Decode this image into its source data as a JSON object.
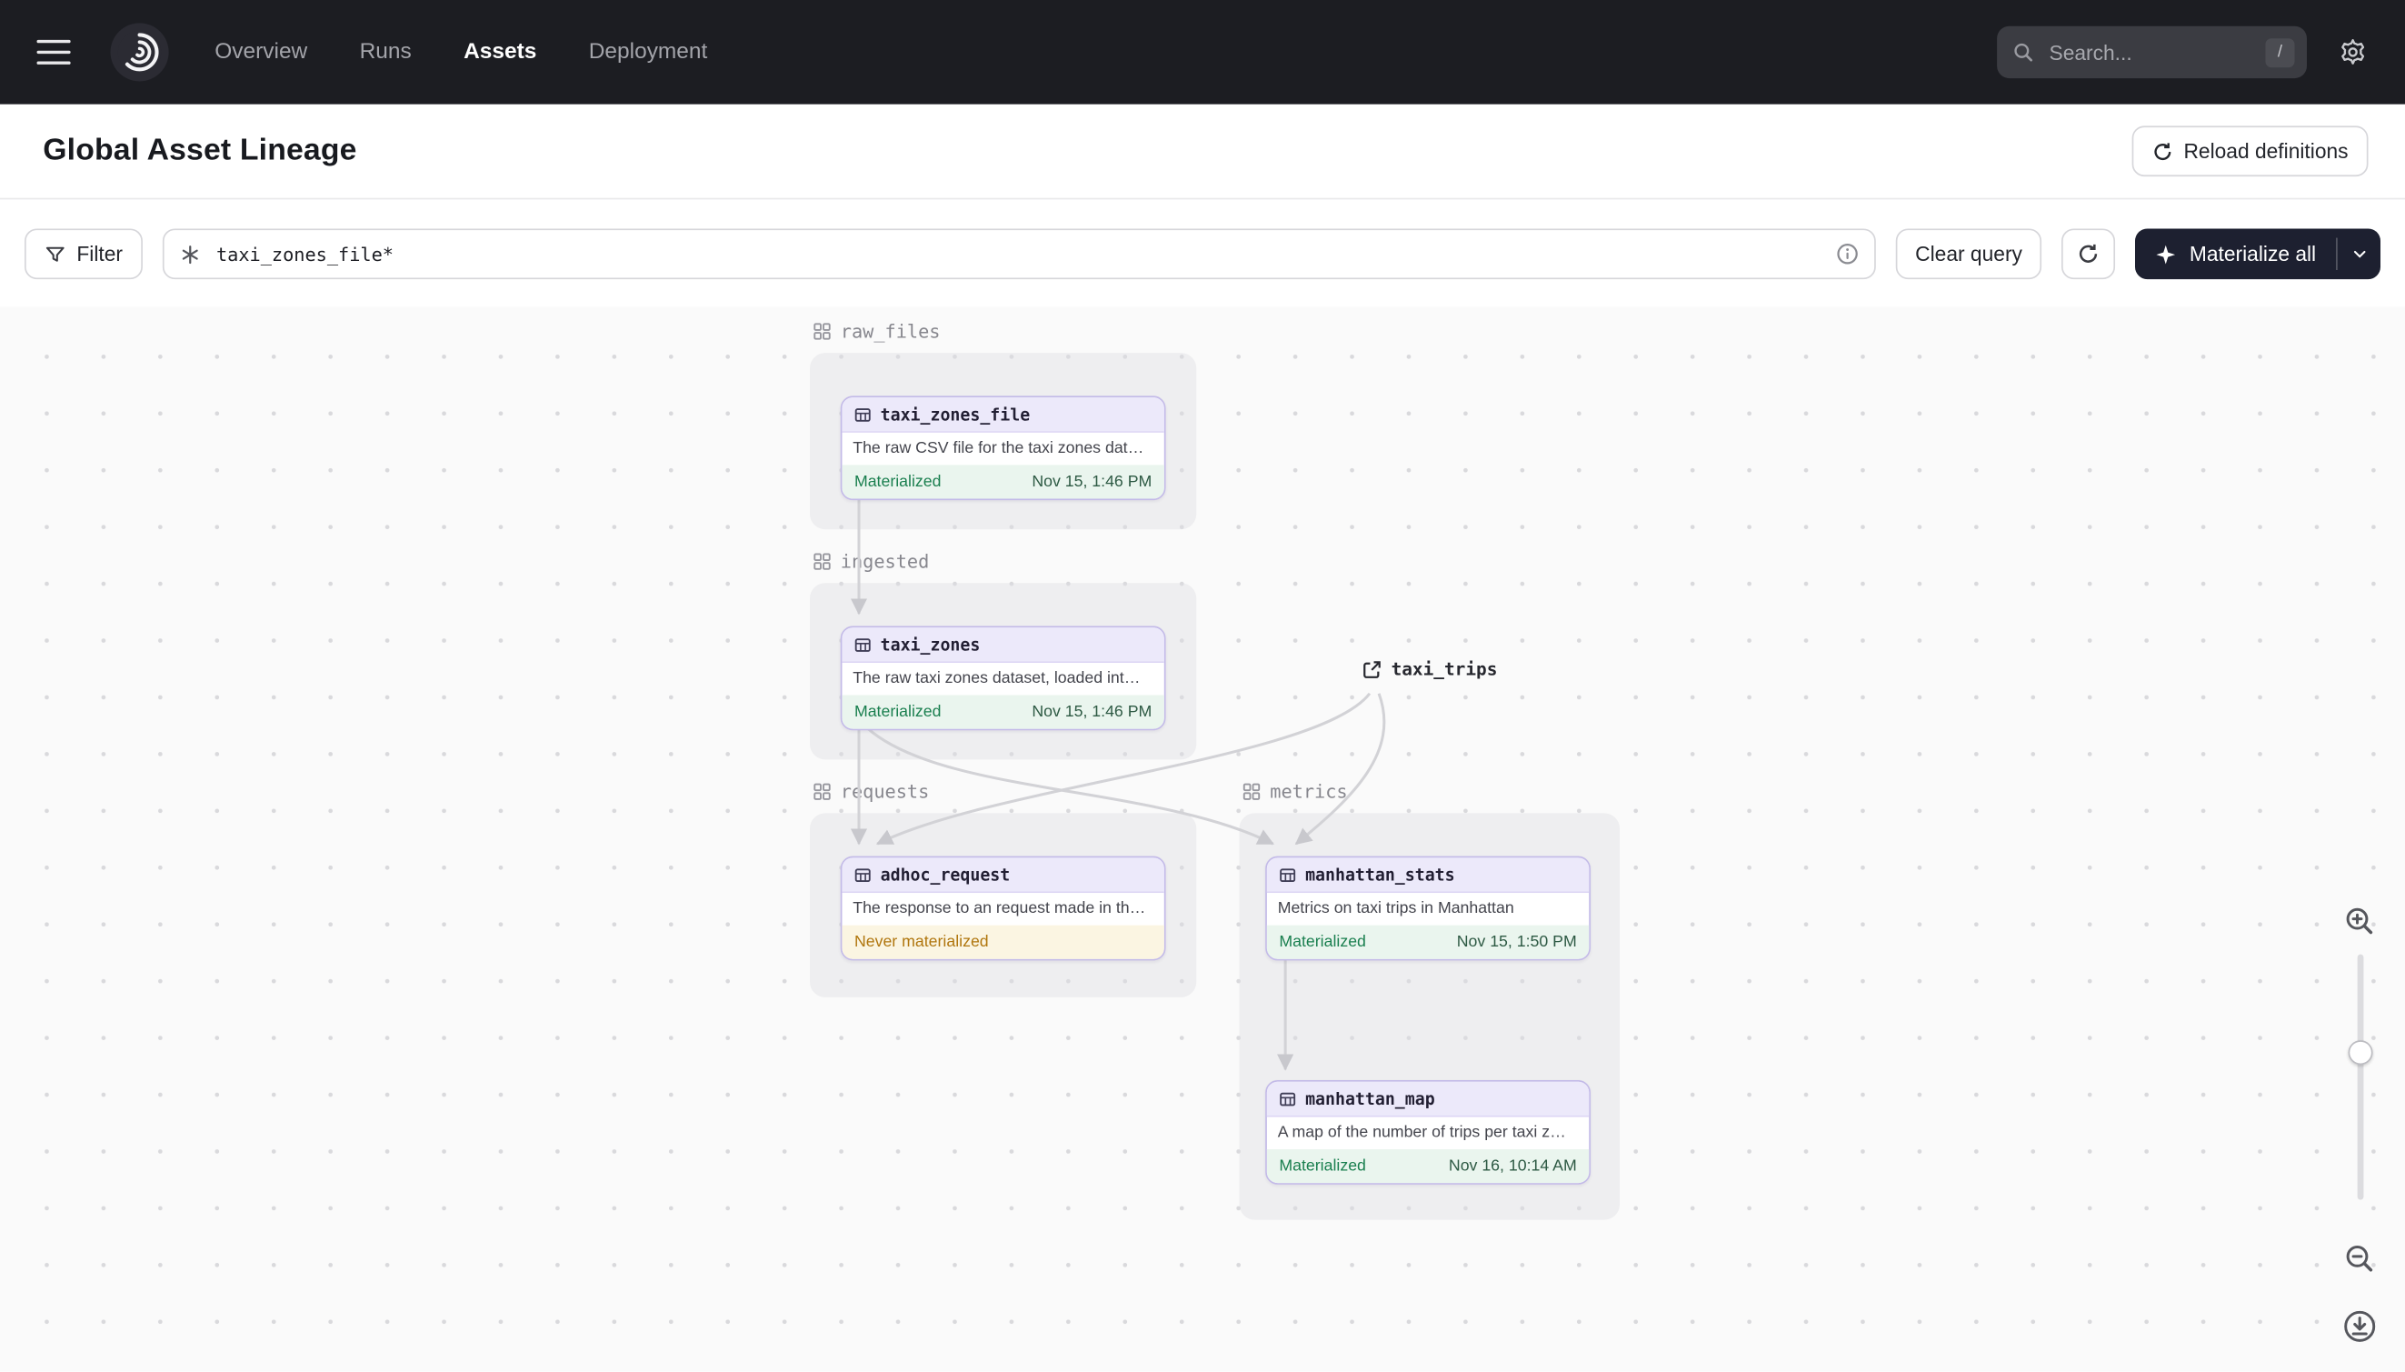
{
  "navbar": {
    "nav_items": [
      {
        "label": "Overview",
        "active": false
      },
      {
        "label": "Runs",
        "active": false
      },
      {
        "label": "Assets",
        "active": true
      },
      {
        "label": "Deployment",
        "active": false
      }
    ],
    "search": {
      "placeholder": "Search...",
      "shortcut": "/"
    }
  },
  "header": {
    "title": "Global Asset Lineage",
    "reload_button_label": "Reload definitions"
  },
  "toolbar": {
    "filter_label": "Filter",
    "query_value": "taxi_zones_file*",
    "clear_query_label": "Clear query",
    "materialize_label": "Materialize all"
  },
  "graph": {
    "groups": [
      {
        "name": "raw_files"
      },
      {
        "name": "ingested"
      },
      {
        "name": "requests"
      },
      {
        "name": "metrics"
      }
    ],
    "external_asset": {
      "name": "taxi_trips"
    },
    "nodes": [
      {
        "name": "taxi_zones_file",
        "description": "The raw CSV file for the taxi zones dat…",
        "status": "Materialized",
        "timestamp": "Nov 15, 1:46 PM"
      },
      {
        "name": "taxi_zones",
        "description": "The raw taxi zones dataset, loaded int…",
        "status": "Materialized",
        "timestamp": "Nov 15, 1:46 PM"
      },
      {
        "name": "adhoc_request",
        "description": "The response to an request made in th…",
        "status": "Never materialized",
        "timestamp": ""
      },
      {
        "name": "manhattan_stats",
        "description": "Metrics on taxi trips in Manhattan",
        "status": "Materialized",
        "timestamp": "Nov 15, 1:50 PM"
      },
      {
        "name": "manhattan_map",
        "description": "A map of the number of trips per taxi z…",
        "status": "Materialized",
        "timestamp": "Nov 16, 10:14 AM"
      }
    ],
    "edges": [
      {
        "from": "taxi_zones_file",
        "to": "taxi_zones"
      },
      {
        "from": "taxi_zones",
        "to": "adhoc_request"
      },
      {
        "from": "taxi_zones",
        "to": "manhattan_stats"
      },
      {
        "from": "taxi_trips",
        "to": "adhoc_request"
      },
      {
        "from": "taxi_trips",
        "to": "manhattan_stats"
      },
      {
        "from": "manhattan_stats",
        "to": "manhattan_map"
      }
    ]
  },
  "colors": {
    "navbar_bg": "#1c1d22",
    "node_accent_purple": "#c3bae8",
    "node_header_bg": "#ece9fa",
    "status_green": "#1a7f4f",
    "status_green_bg": "#eaf5ee",
    "status_amber": "#b0760e",
    "status_amber_bg": "#fbf5e2",
    "materialize_button_bg": "#1d2030"
  }
}
